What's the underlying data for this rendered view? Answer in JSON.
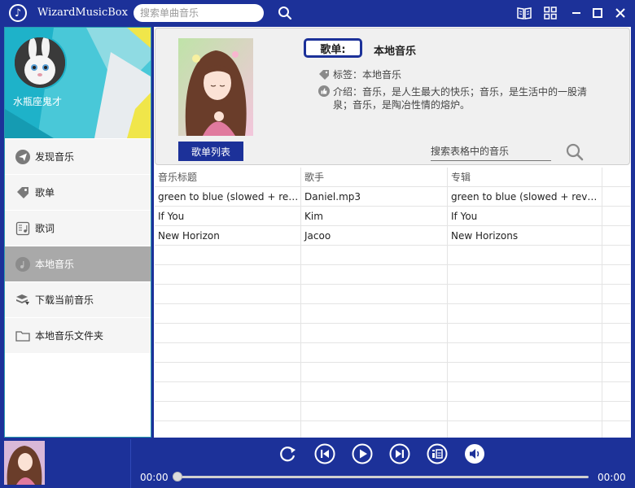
{
  "app": {
    "title": "WizardMusicBox"
  },
  "search": {
    "placeholder": "搜索单曲音乐"
  },
  "user": {
    "name": "水瓶座鬼才"
  },
  "menu": {
    "items": [
      {
        "label": "发现音乐",
        "icon": "send-icon"
      },
      {
        "label": "歌单",
        "icon": "tag-icon"
      },
      {
        "label": "歌词",
        "icon": "lyrics-icon"
      },
      {
        "label": "本地音乐",
        "icon": "music-note-icon",
        "active": true
      },
      {
        "label": "下载当前音乐",
        "icon": "download-icon"
      },
      {
        "label": "本地音乐文件夹",
        "icon": "folder-icon"
      }
    ]
  },
  "playlist": {
    "tag_label": "歌单:",
    "name": "本地音乐",
    "tags": "标签：本地音乐",
    "intro": "介绍：音乐，是人生最大的快乐；音乐，是生活中的一股清泉；音乐，是陶冶性情的熔炉。",
    "list_button": "歌单列表",
    "table_search_placeholder": "搜索表格中的音乐"
  },
  "table": {
    "headers": [
      "音乐标题",
      "歌手",
      "专辑",
      ""
    ],
    "rows": [
      [
        "green to blue (slowed + reverb)",
        "Daniel.mp3",
        "green to blue (slowed + reverb)",
        ""
      ],
      [
        "If You",
        "Kim",
        "If You",
        ""
      ],
      [
        "New Horizon",
        "Jacoo",
        "New Horizons",
        ""
      ]
    ]
  },
  "player": {
    "current_time": "00:00",
    "total_time": "00:00",
    "progress": 0
  },
  "colors": {
    "primary": "#1c3199",
    "banner": "#1eb2c9",
    "active_menu": "#a9a9a9"
  }
}
